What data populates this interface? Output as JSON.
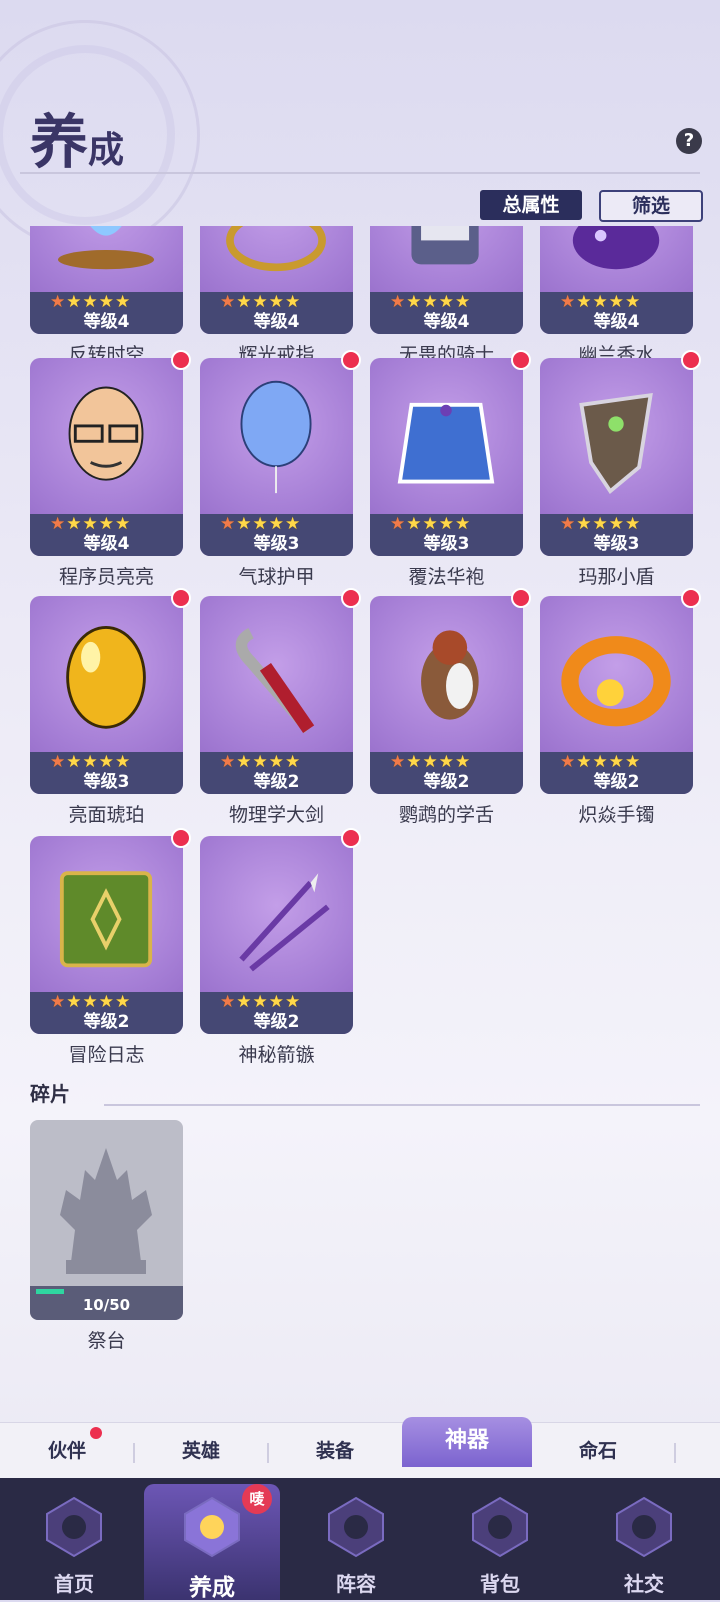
{
  "header": {
    "title_big": "养",
    "title_small": "成",
    "help_icon": "question-icon"
  },
  "toolbar": {
    "total_attr_label": "总属性",
    "filter_label": "筛选"
  },
  "items": [
    {
      "name": "反转时空",
      "level": "等级4",
      "stars": "★★★★★",
      "art": "hourglass"
    },
    {
      "name": "辉光戒指",
      "level": "等级4",
      "stars": "★★★★★",
      "art": "ring"
    },
    {
      "name": "无畏的骑士",
      "level": "等级4",
      "stars": "★★★★★",
      "art": "knight"
    },
    {
      "name": "幽兰香水",
      "level": "等级4",
      "stars": "★★★★★",
      "art": "perfume"
    },
    {
      "name": "程序员亮亮",
      "level": "等级4",
      "stars": "★★★★★",
      "art": "face"
    },
    {
      "name": "气球护甲",
      "level": "等级3",
      "stars": "★★★★★",
      "art": "balloon"
    },
    {
      "name": "覆法华袍",
      "level": "等级3",
      "stars": "★★★★★",
      "art": "robe"
    },
    {
      "name": "玛那小盾",
      "level": "等级3",
      "stars": "★★★★★",
      "art": "shield"
    },
    {
      "name": "亮面琥珀",
      "level": "等级3",
      "stars": "★★★★★",
      "art": "amber"
    },
    {
      "name": "物理学大剑",
      "level": "等级2",
      "stars": "★★★★★",
      "art": "crowbar"
    },
    {
      "name": "鹦鹉的学舌",
      "level": "等级2",
      "stars": "★★★★★",
      "art": "parrot"
    },
    {
      "name": "炽焱手镯",
      "level": "等级2",
      "stars": "★★★★★",
      "art": "bracelet"
    },
    {
      "name": "冒险日志",
      "level": "等级2",
      "stars": "★★★★★",
      "art": "book"
    },
    {
      "name": "神秘箭镞",
      "level": "等级2",
      "stars": "★★★★★",
      "art": "arrows"
    }
  ],
  "fragments": {
    "title": "碎片",
    "items": [
      {
        "name": "祭台",
        "count": "10/50",
        "progress": 0.2
      }
    ]
  },
  "subtabs": [
    {
      "label": "伙伴",
      "active": false,
      "badge": true
    },
    {
      "label": "英雄",
      "active": false,
      "badge": false
    },
    {
      "label": "装备",
      "active": false,
      "badge": false
    },
    {
      "label": "神器",
      "active": true,
      "badge": false
    },
    {
      "label": "命石",
      "active": false,
      "badge": false
    }
  ],
  "nav": [
    {
      "label": "首页",
      "icon": "home-icon",
      "selected": false
    },
    {
      "label": "养成",
      "icon": "cultivate-icon",
      "selected": true,
      "badge": "唛"
    },
    {
      "label": "阵容",
      "icon": "lineup-icon",
      "selected": false
    },
    {
      "label": "背包",
      "icon": "backpack-icon",
      "selected": false
    },
    {
      "label": "社交",
      "icon": "social-icon",
      "selected": false
    }
  ],
  "colors": {
    "accent": "#7b63cf",
    "dark": "#2b2e5c",
    "badge": "#ec2f4f",
    "star": "#ffd84a"
  }
}
